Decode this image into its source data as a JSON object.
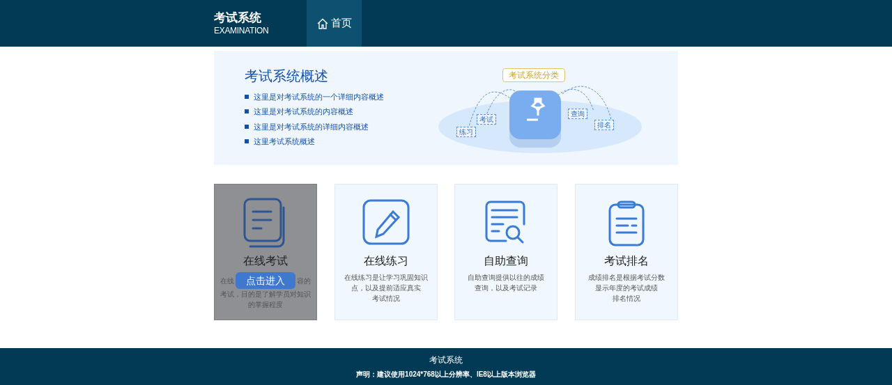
{
  "header": {
    "logo_title": "考试系统",
    "logo_subtitle": "EXAMINATION",
    "nav": [
      {
        "label": "首页",
        "selected": true
      }
    ]
  },
  "banner": {
    "title": "考试系统概述",
    "items": [
      "这里是对考试系统的一个详细内容概述",
      "这里是对考试系统的内容概述",
      "这里是对考试系统的详细内容概述",
      "这里考试系统概述"
    ],
    "category_label": "考试系统分类",
    "tags": [
      "练习",
      "考试",
      "查询",
      "排名"
    ]
  },
  "cards": [
    {
      "kind": "exam",
      "title": "在线考试",
      "hovered": true,
      "desc_left": "在线",
      "desc_right": "容的",
      "description": [
        "考试，目的是了解学员对知识",
        "的掌握程度"
      ],
      "button": "点击进入"
    },
    {
      "kind": "practice",
      "title": "在线练习",
      "hovered": false,
      "description": [
        "在线练习是让学习巩固知识",
        "点，以及提前适应真实",
        "考试情况"
      ]
    },
    {
      "kind": "query",
      "title": "自助查询",
      "hovered": false,
      "description": [
        "自助查询提供以往的成绩",
        "查询，以及考试记录"
      ]
    },
    {
      "kind": "rank",
      "title": "考试排名",
      "hovered": false,
      "description": [
        "成绩排名是根据考试分数",
        "显示年度的考试成绩",
        "排名情况"
      ]
    }
  ],
  "footer": {
    "title": "考试系统",
    "notice": "声明：建议使用1024*768以上分辨率、IE8以上版本浏览器"
  }
}
